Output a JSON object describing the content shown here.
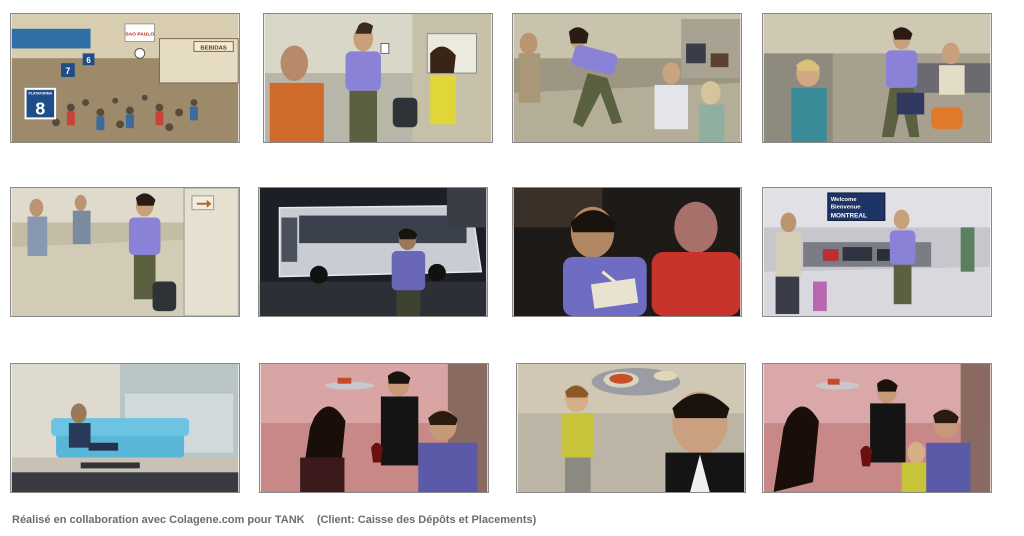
{
  "caption": "Réalisé en collaboration avec Colagene.com pour TANK    (Client: Caisse des Dépôts et Placements)",
  "panels": [
    {
      "id": "p1",
      "signs": {
        "platform_number": "8",
        "platform_label": "PLATAFORMA",
        "destination": "SAO PAULO",
        "bebidas": "BEBIDAS",
        "gate7": "7",
        "gate6": "6"
      }
    },
    {
      "id": "p2"
    },
    {
      "id": "p3"
    },
    {
      "id": "p4"
    },
    {
      "id": "p5"
    },
    {
      "id": "p6"
    },
    {
      "id": "p7"
    },
    {
      "id": "p8",
      "signs": {
        "welcome_line1": "Welcome",
        "welcome_line2": "Bienvenue",
        "city": "MONTREAL"
      }
    },
    {
      "id": "p9"
    },
    {
      "id": "p10"
    },
    {
      "id": "p11"
    },
    {
      "id": "p12"
    }
  ]
}
